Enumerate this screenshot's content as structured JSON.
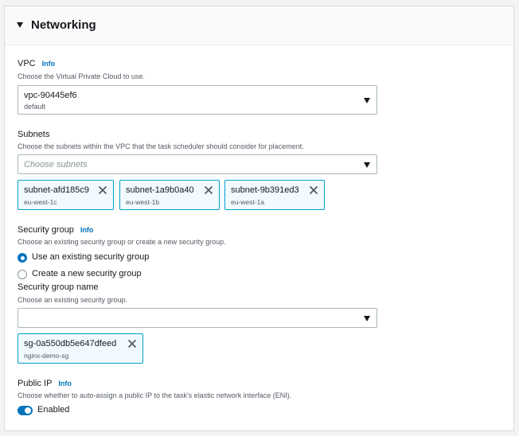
{
  "section": {
    "title": "Networking"
  },
  "vpc": {
    "label": "VPC",
    "info": "Info",
    "description": "Choose the Virtual Private Cloud to use.",
    "value": "vpc-90445ef6",
    "sub": "default"
  },
  "subnets": {
    "label": "Subnets",
    "description": "Choose the subnets within the VPC that the task scheduler should consider for placement.",
    "placeholder": "Choose subnets",
    "tokens": [
      {
        "name": "subnet-afd185c9",
        "region": "eu-west-1c"
      },
      {
        "name": "subnet-1a9b0a40",
        "region": "eu-west-1b"
      },
      {
        "name": "subnet-9b391ed3",
        "region": "eu-west-1a"
      }
    ]
  },
  "security_group": {
    "label": "Security group",
    "info": "Info",
    "description": "Choose an existing security group or create a new security group.",
    "options": [
      "Use an existing security group",
      "Create a new security group"
    ],
    "selected": "Use an existing security group",
    "name_label": "Security group name",
    "name_description": "Choose an existing security group.",
    "name_value": "",
    "token": {
      "name": "sg-0a550db5e647dfeed",
      "sub": "nginx-demo-sg"
    }
  },
  "public_ip": {
    "label": "Public IP",
    "info": "Info",
    "description": "Choose whether to auto-assign a public IP to the task's elastic network interface (ENI).",
    "toggle_label": "Enabled",
    "enabled": true
  },
  "colors": {
    "link": "#0073bb",
    "token_border": "#00a1c9",
    "token_bg": "#f1faff",
    "toggle_on": "#0073bb"
  }
}
